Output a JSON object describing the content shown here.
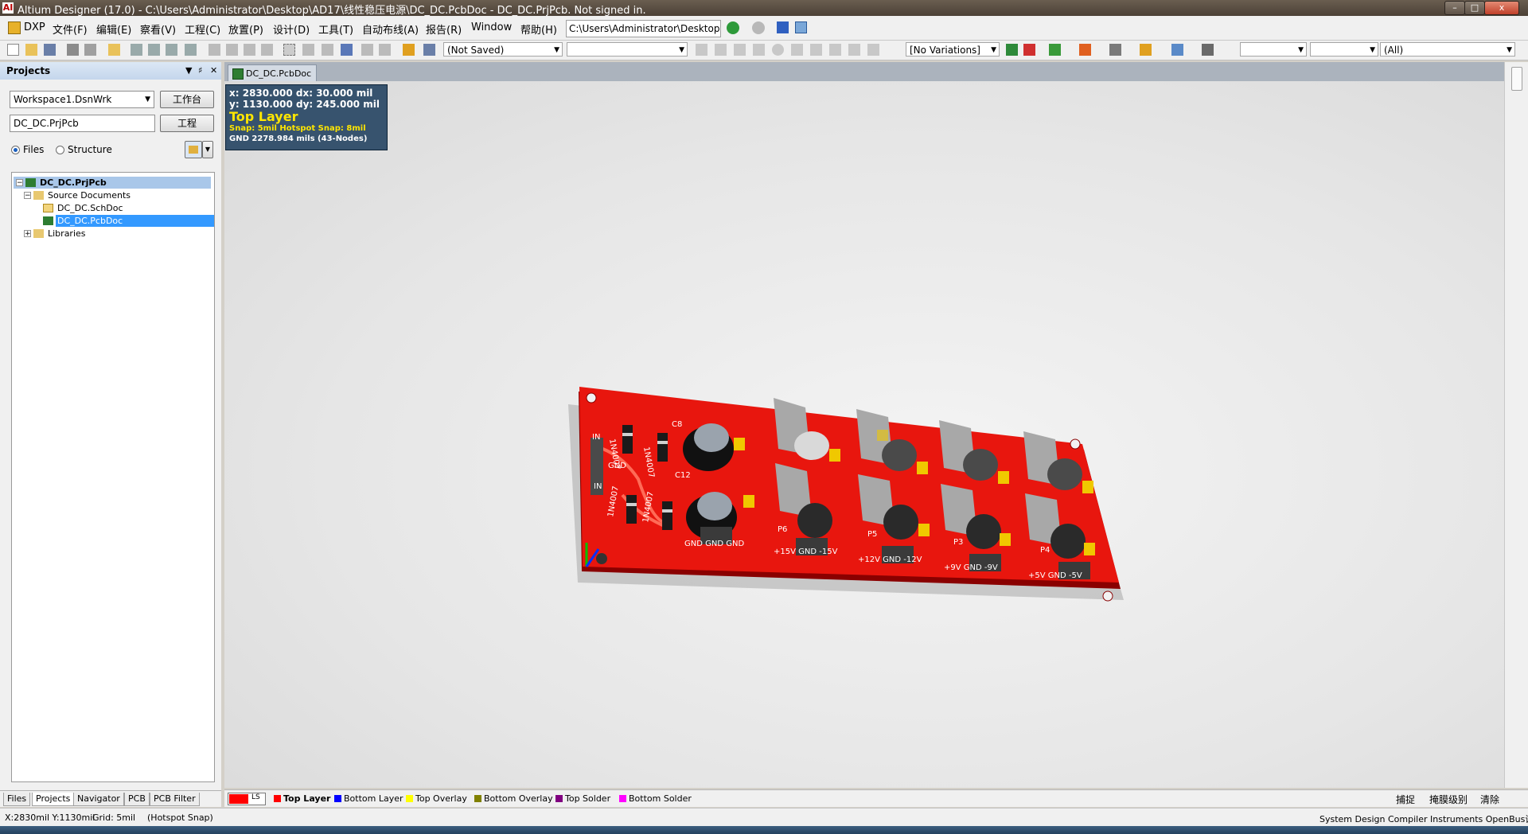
{
  "window": {
    "title": "Altium Designer (17.0) - C:\\Users\\Administrator\\Desktop\\AD17\\线性稳压电源\\DC_DC.PcbDoc - DC_DC.PrjPcb. Not signed in.",
    "app_icon_label": "AI",
    "minimize_label": "–",
    "maximize_label": "□",
    "close_label": "x"
  },
  "menu": {
    "items": [
      "DXP",
      "文件(F)",
      "编辑(E)",
      "察看(V)",
      "工程(C)",
      "放置(P)",
      "设计(D)",
      "工具(T)",
      "自动布线(A)",
      "报告(R)",
      "Window",
      "帮助(H)"
    ],
    "path": "C:\\Users\\Administrator\\Desktop"
  },
  "toolbar": {
    "save_state": "(Not Saved)",
    "blank_combo": "",
    "variations": "[No Variations]",
    "combo_a": "",
    "combo_b": "",
    "filter": "(All)",
    "colors": {
      "accent": "#3399ff",
      "red": "#ff0000"
    }
  },
  "projects_panel": {
    "title": "Projects",
    "header_buttons": [
      "▼",
      "♯",
      "✕"
    ],
    "workspace": "Workspace1.DsnWrk",
    "workspace_button": "工作台",
    "project": "DC_DC.PrjPcb",
    "project_button": "工程",
    "view_modes": [
      "Files",
      "Structure"
    ],
    "selected_view": "Files",
    "tree": [
      {
        "label": "DC_DC.PrjPcb",
        "level": 0,
        "expander": "−",
        "icon": "pcb-project-icon",
        "state": "selected-dim"
      },
      {
        "label": "Source Documents",
        "level": 1,
        "expander": "−",
        "icon": "folder-icon",
        "state": ""
      },
      {
        "label": "DC_DC.SchDoc",
        "level": 2,
        "expander": "",
        "icon": "schematic-doc-icon",
        "state": ""
      },
      {
        "label": "DC_DC.PcbDoc",
        "level": 2,
        "expander": "",
        "icon": "pcb-doc-icon",
        "state": "selected"
      },
      {
        "label": "Libraries",
        "level": 1,
        "expander": "+",
        "icon": "folder-icon",
        "state": ""
      }
    ],
    "tabs": [
      "Files",
      "Projects",
      "Navigator",
      "PCB",
      "PCB Filter"
    ],
    "active_tab": "Projects"
  },
  "document": {
    "tab": "DC_DC.PcbDoc"
  },
  "hud": {
    "line1": "x:  2830.000   dx:    30.000  mil",
    "line2": "y:  1130.000   dy:  245.000  mil",
    "layer": "Top Layer",
    "snap": "Snap: 5mil Hotspot Snap: 8mil",
    "net": "GND    2278.984 mils  (43-Nodes)"
  },
  "pcb_labels": {
    "diodes": [
      "1N4007",
      "1N4007",
      "1N4007",
      "1N4007"
    ],
    "caps": [
      "C8",
      "C12"
    ],
    "connectors": [
      "P6",
      "P5",
      "P3",
      "P4"
    ],
    "input_labels": [
      "IN",
      "GND",
      "IN"
    ],
    "headers": [
      "GND  GND  GND",
      "+15V  GND  -15V",
      "+12V  GND  -12V",
      "+9V  GND  -9V",
      "+5V  GND  -5V"
    ]
  },
  "layers": {
    "indicator": "LS",
    "tabs": [
      {
        "label": "Top Layer",
        "color": "#ff0000",
        "active": true
      },
      {
        "label": "Bottom Layer",
        "color": "#0000ff",
        "active": false
      },
      {
        "label": "Top Overlay",
        "color": "#ffff00",
        "active": false
      },
      {
        "label": "Bottom Overlay",
        "color": "#808000",
        "active": false
      },
      {
        "label": "Top Solder",
        "color": "#800080",
        "active": false
      },
      {
        "label": "Bottom Solder",
        "color": "#ff00ff",
        "active": false
      }
    ],
    "right_buttons": [
      "捕捉",
      "掩膜级别",
      "清除"
    ]
  },
  "status": {
    "coords": "X:2830mil Y:1130mil",
    "grid": "Grid: 5mil",
    "snap": "(Hotspot Snap)",
    "right": "System   Design Compiler   Instruments   OpenBus调色板   >>"
  }
}
